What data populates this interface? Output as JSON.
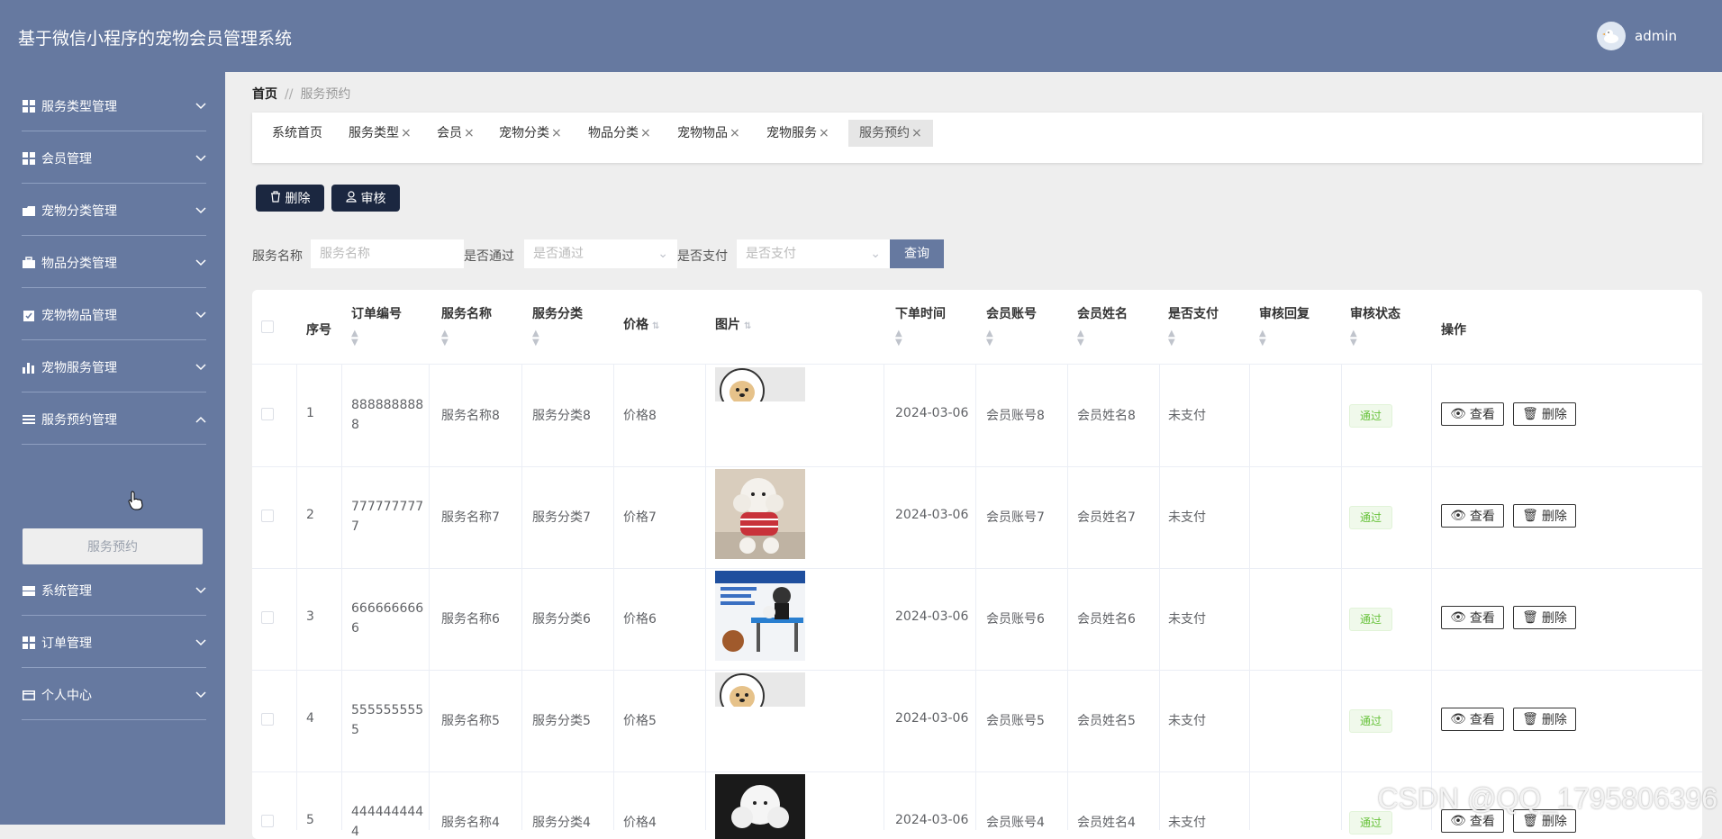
{
  "app": {
    "title": "基于微信小程序的宠物会员管理系统",
    "user": "admin"
  },
  "sidebar": {
    "items": [
      {
        "label": "服务类型管理",
        "icon": "grid-icon"
      },
      {
        "label": "会员管理",
        "icon": "grid-icon"
      },
      {
        "label": "宠物分类管理",
        "icon": "folder-icon"
      },
      {
        "label": "物品分类管理",
        "icon": "briefcase-icon"
      },
      {
        "label": "宠物物品管理",
        "icon": "clipboard-icon"
      },
      {
        "label": "宠物服务管理",
        "icon": "bar-chart-icon"
      },
      {
        "label": "服务预约管理",
        "icon": "list-icon"
      },
      {
        "label": "系统管理",
        "icon": "server-icon"
      },
      {
        "label": "订单管理",
        "icon": "grid-icon"
      },
      {
        "label": "个人中心",
        "icon": "card-icon"
      }
    ],
    "submenu": {
      "label": "服务预约"
    }
  },
  "breadcrumb": {
    "home": "首页",
    "separator": "//",
    "current": "服务预约"
  },
  "tabs": [
    "系统首页",
    "服务类型",
    "会员",
    "宠物分类",
    "物品分类",
    "宠物物品",
    "宠物服务",
    "服务预约"
  ],
  "toolbar": {
    "delete_label": "删除",
    "audit_label": "审核"
  },
  "search": {
    "name_label": "服务名称",
    "name_placeholder": "服务名称",
    "passed_label": "是否通过",
    "passed_placeholder": "是否通过",
    "paid_label": "是否支付",
    "paid_placeholder": "是否支付",
    "query_label": "查询"
  },
  "table": {
    "headers": {
      "index": "序号",
      "order_no": "订单编号",
      "service_name": "服务名称",
      "service_type": "服务分类",
      "price": "价格",
      "image": "图片",
      "order_time": "下单时间",
      "member_account": "会员账号",
      "member_name": "会员姓名",
      "paid": "是否支付",
      "reply": "审核回复",
      "status": "审核状态",
      "actions": "操作"
    },
    "view_label": "查看",
    "delete_label": "删除",
    "rows": [
      {
        "index": "1",
        "order_no_a": "888888888",
        "order_no_b": "8",
        "service_name": "服务名称8",
        "service_type": "服务分类8",
        "price": "价格8",
        "order_time": "2024-03-06",
        "member_account": "会员账号8",
        "member_name": "会员姓名8",
        "paid": "未支付",
        "reply": "",
        "status": "通过"
      },
      {
        "index": "2",
        "order_no_a": "777777777",
        "order_no_b": "7",
        "service_name": "服务名称7",
        "service_type": "服务分类7",
        "price": "价格7",
        "order_time": "2024-03-06",
        "member_account": "会员账号7",
        "member_name": "会员姓名7",
        "paid": "未支付",
        "reply": "",
        "status": "通过"
      },
      {
        "index": "3",
        "order_no_a": "666666666",
        "order_no_b": "6",
        "service_name": "服务名称6",
        "service_type": "服务分类6",
        "price": "价格6",
        "order_time": "2024-03-06",
        "member_account": "会员账号6",
        "member_name": "会员姓名6",
        "paid": "未支付",
        "reply": "",
        "status": "通过"
      },
      {
        "index": "4",
        "order_no_a": "555555555",
        "order_no_b": "5",
        "service_name": "服务名称5",
        "service_type": "服务分类5",
        "price": "价格5",
        "order_time": "2024-03-06",
        "member_account": "会员账号5",
        "member_name": "会员姓名5",
        "paid": "未支付",
        "reply": "",
        "status": "通过"
      },
      {
        "index": "5",
        "order_no_a": "444444444",
        "order_no_b": "4",
        "service_name": "服务名称4",
        "service_type": "服务分类4",
        "price": "价格4",
        "order_time": "2024-03-06",
        "member_account": "会员账号4",
        "member_name": "会员姓名4",
        "paid": "未支付",
        "reply": "",
        "status": "通过"
      }
    ]
  },
  "watermark": "CSDN @QQ_1795806396",
  "colors": {
    "primary": "#6679a0",
    "dark_button": "#1b2740",
    "success": "#67c23a"
  }
}
